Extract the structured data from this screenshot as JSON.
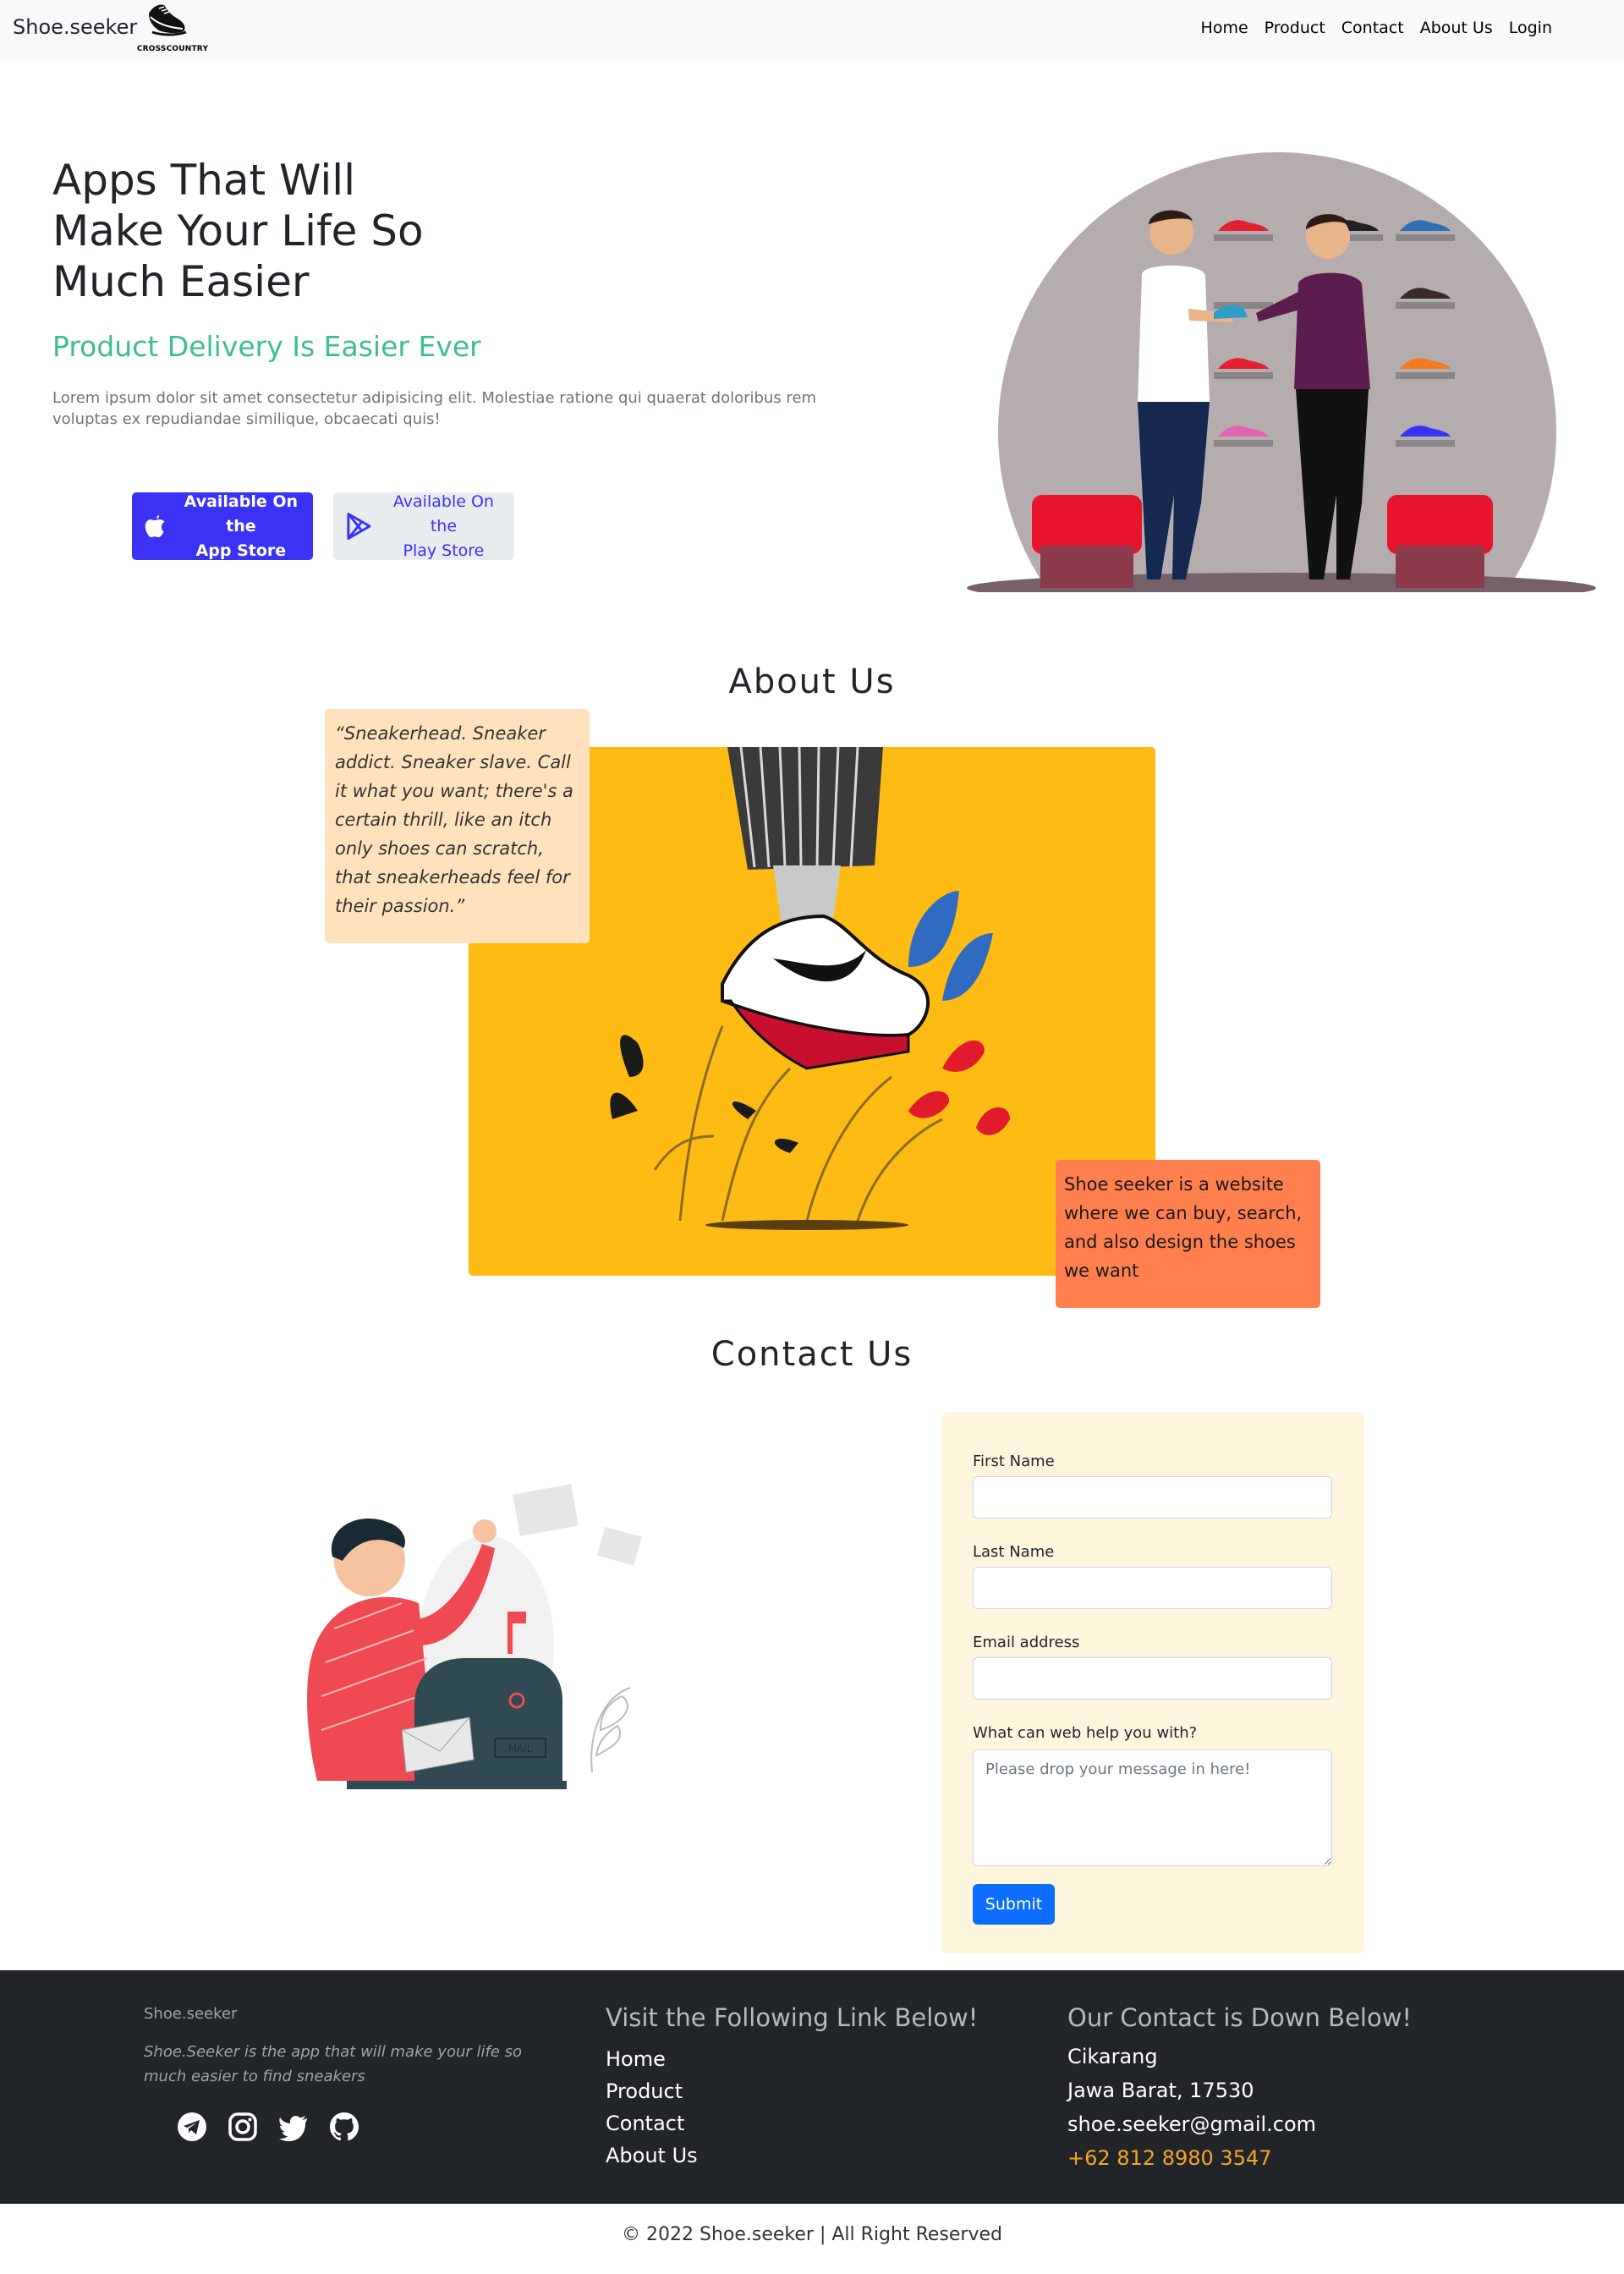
{
  "nav": {
    "brand": "Shoe.seeker",
    "logo_tag": "CROSSCOUNTRY",
    "links": [
      "Home",
      "Product",
      "Contact",
      "About Us",
      "Login"
    ]
  },
  "hero": {
    "title": "Apps That Will Make Your Life So Much Easier",
    "subtitle": "Product Delivery Is Easier Ever",
    "lorem": "Lorem ipsum dolor sit amet consectetur adipisicing elit. Molestiae ratione qui quaerat doloribus rem voluptas ex repudiandae similique, obcaecati quis!",
    "app_store": {
      "line1": "Available On the",
      "line2": "App Store"
    },
    "play_store": {
      "line1": "Available On the",
      "line2": "Play Store"
    }
  },
  "about": {
    "title": "About Us",
    "quote": "“Sneakerhead. Sneaker addict. Sneaker slave. Call it what you want; there's a certain thrill, like an itch only shoes can scratch, that sneakerheads feel for their passion.”",
    "description": "Shoe seeker is a website where we can buy, search, and also design the shoes we want"
  },
  "contact": {
    "title": "Contact Us",
    "first_name_label": "First Name",
    "last_name_label": "Last Name",
    "email_label": "Email address",
    "message_label": "What can web help you with?",
    "message_placeholder": "Please drop your message in here!",
    "mailbox_label": "MAIL",
    "submit": "Submit"
  },
  "footer": {
    "brand": "Shoe.seeker",
    "tagline": "Shoe.Seeker is the app that will make your life so much easier to find sneakers",
    "links_title": "Visit the Following Link Below!",
    "links": [
      "Home",
      "Product",
      "Contact",
      "About Us"
    ],
    "contact_title": "Our Contact is Down Below!",
    "city": "Cikarang",
    "region": "Jawa Barat, 17530",
    "email": "shoe.seeker@gmail.com",
    "phone": "+62 812 8980 3547",
    "socials": [
      "telegram-icon",
      "instagram-icon",
      "twitter-icon",
      "github-icon"
    ]
  },
  "copyright": "© 2022 Shoe.seeker | All Right Reserved",
  "colors": {
    "accent_green": "#3bbf8c",
    "app_store_blue": "#3a32f5",
    "about_yellow": "#fdbb14",
    "quote_bg": "#ffe2bd",
    "desc_bg": "#ff7f4e",
    "form_bg": "#fef6dc",
    "submit_blue": "#0d6efd",
    "footer_bg": "#212529",
    "phone_orange": "#f5a623"
  }
}
